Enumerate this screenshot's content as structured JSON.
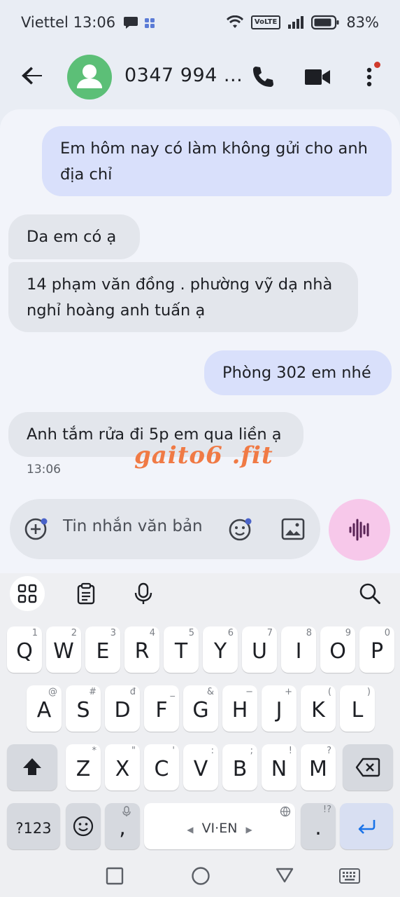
{
  "status_bar": {
    "carrier": "Viettel",
    "time": "13:06",
    "network": "VoLTE",
    "battery": "83%"
  },
  "header": {
    "contact": "0347 994 ..."
  },
  "messages": [
    {
      "direction": "out",
      "text": "Em hôm nay có làm không gửi cho anh địa chỉ"
    },
    {
      "direction": "in",
      "text": "Da em có ạ"
    },
    {
      "direction": "in",
      "text": "14 phạm văn đồng . phường vỹ dạ nhà nghỉ hoàng anh tuấn ạ"
    },
    {
      "direction": "out",
      "text": "Phòng 302 em nhé"
    },
    {
      "direction": "in",
      "text": "Anh tắm rửa đi 5p em qua liền ạ"
    }
  ],
  "last_timestamp": "13:06",
  "watermark": "gaito6 .fit",
  "composer": {
    "placeholder": "Tin nhắn văn bản"
  },
  "keyboard": {
    "row1": [
      "Q",
      "W",
      "E",
      "R",
      "T",
      "Y",
      "U",
      "I",
      "O",
      "P"
    ],
    "row1_hints": [
      "1",
      "2",
      "3",
      "4",
      "5",
      "6",
      "7",
      "8",
      "9",
      "0"
    ],
    "row2": [
      "A",
      "S",
      "D",
      "F",
      "G",
      "H",
      "J",
      "K",
      "L"
    ],
    "row2_hints": [
      "@",
      "#",
      "đ",
      "_",
      "&",
      "−",
      "+",
      "(",
      ")"
    ],
    "row3": [
      "Z",
      "X",
      "C",
      "V",
      "B",
      "N",
      "M"
    ],
    "row3_hints": [
      "*",
      "\"",
      "'",
      ":",
      ";",
      "!",
      "?"
    ],
    "symbols_label": "?123",
    "comma": ",",
    "space_label": "VI·EN",
    "period": ".",
    "period_hint": "!?"
  },
  "colors": {
    "accent": "#1a73e8",
    "outgoing_bubble": "#d9e0fb",
    "incoming_bubble": "#e3e6ec",
    "avatar": "#5cbf77",
    "mic_button": "#f7c8ea",
    "watermark": "#f07a45"
  }
}
